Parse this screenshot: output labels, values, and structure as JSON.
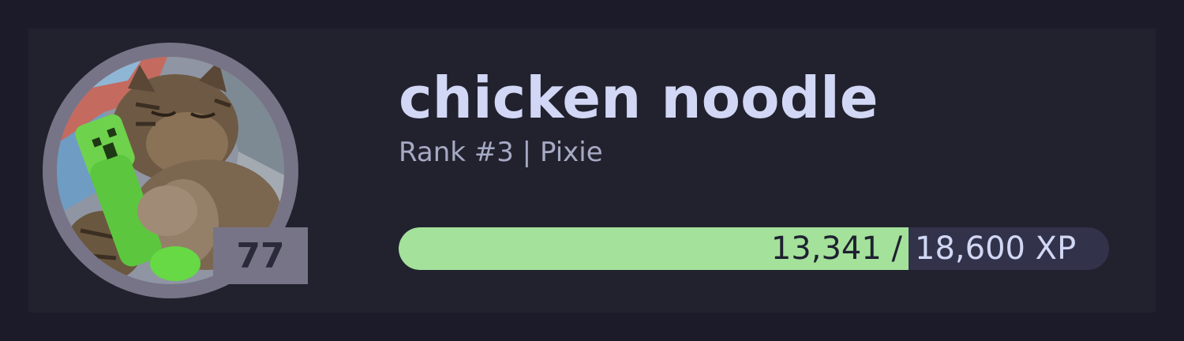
{
  "profile": {
    "username": "chicken noodle",
    "subtitle": "Rank #3 | Pixie",
    "level": "77",
    "avatar_icon": "cat-with-creeper-plush-photo"
  },
  "xp": {
    "current_label": "13,341 /",
    "max_label": "18,600 XP",
    "current": 13341,
    "max": 18600,
    "fill_color": "#a4e19b",
    "track_color": "#32324a"
  },
  "colors": {
    "background": "#1b1b29",
    "card": "#22222f",
    "ring": "#777487",
    "name": "#d1d7f4",
    "subtitle": "#a6aac4"
  }
}
